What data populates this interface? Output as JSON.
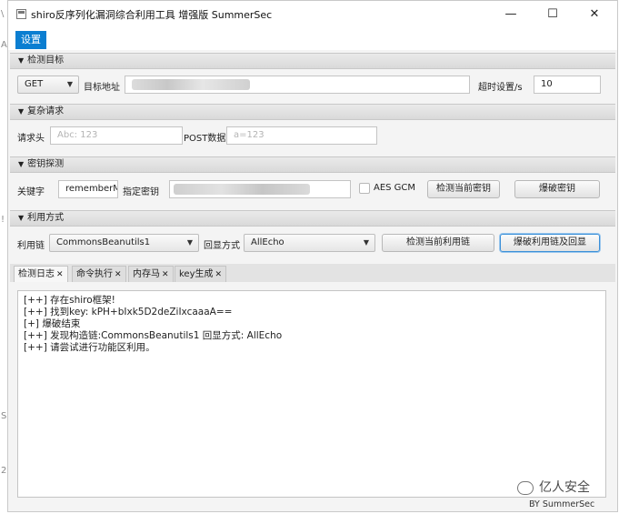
{
  "window": {
    "title": "shiro反序列化漏洞综合利用工具 增强版 SummerSec",
    "controls": {
      "minimize": "—",
      "maximize": "☐",
      "close": "✕"
    }
  },
  "left_fragments": [
    "\\",
    "A",
    "!",
    "S",
    "2"
  ],
  "menu": {
    "settings": "设置"
  },
  "sections": {
    "target": {
      "header": "检测目标",
      "method": "GET",
      "target_label": "目标地址",
      "timeout_label": "超时设置/s",
      "timeout_value": "10"
    },
    "complex": {
      "header": "复杂请求",
      "headers_label": "请求头",
      "headers_placeholder": "Abc: 123",
      "post_label": "POST数据",
      "post_placeholder": "a=123"
    },
    "key": {
      "header": "密钥探测",
      "keyword_label": "关键字",
      "keyword_value": "rememberM",
      "specify_key_label": "指定密钥",
      "aes_gcm_label": "AES GCM",
      "check_key_button": "检测当前密钥",
      "brute_key_button": "爆破密钥"
    },
    "exploit": {
      "header": "利用方式",
      "chain_label": "利用链",
      "chain_value": "CommonsBeanutils1",
      "echo_label": "回显方式",
      "echo_value": "AllEcho",
      "check_chain_button": "检测当前利用链",
      "brute_chain_button": "爆破利用链及回显"
    }
  },
  "tabs": [
    {
      "label": "检测日志",
      "close": "✕"
    },
    {
      "label": "命令执行",
      "close": "✕"
    },
    {
      "label": "内存马",
      "close": "✕"
    },
    {
      "label": "key生成",
      "close": "✕"
    }
  ],
  "log_lines": [
    "[++] 存在shiro框架!",
    "[++] 找到key:  kPH+bIxk5D2deZiIxcaaaA==",
    "[+] 爆破结束",
    "[++] 发现构造链:CommonsBeanutils1  回显方式: AllEcho",
    "[++] 请尝试进行功能区利用。"
  ],
  "footer": "BY  SummerSec",
  "watermark": "亿人安全",
  "colors": {
    "accent": "#0b7ed1",
    "focus_border": "#3a8fd8"
  }
}
